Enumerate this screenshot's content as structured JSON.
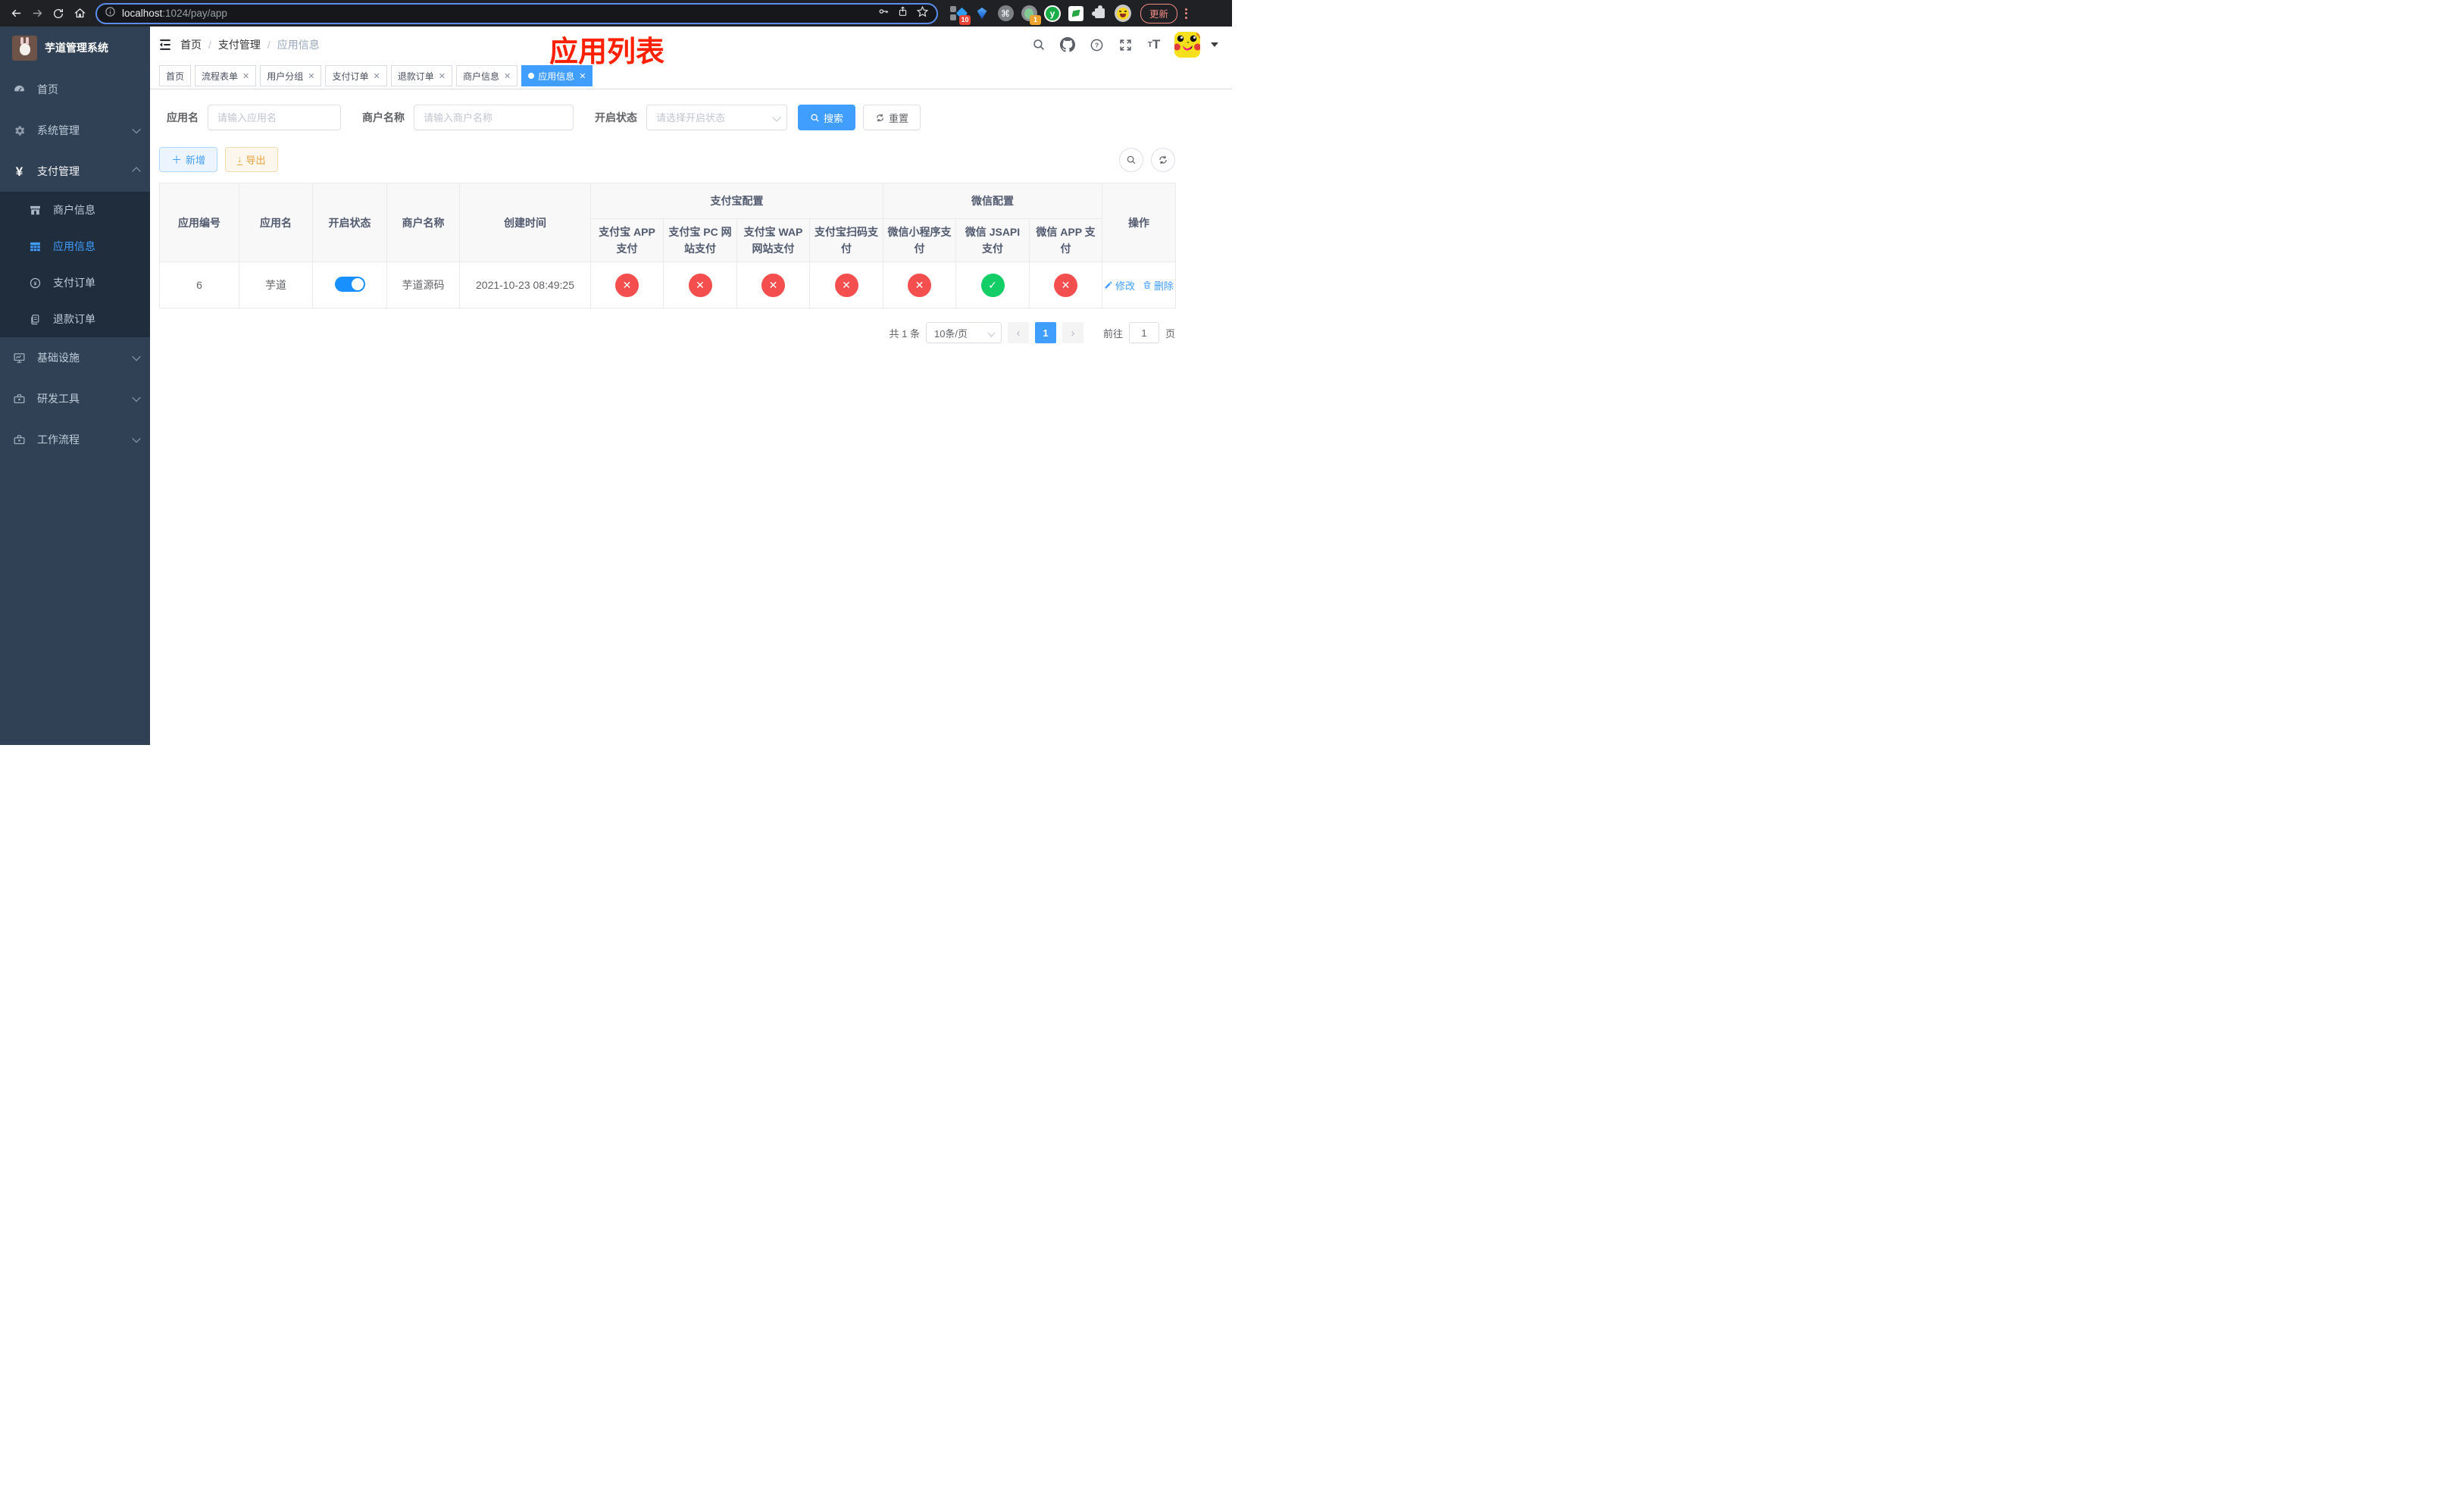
{
  "browser": {
    "url_host": "localhost",
    "url_rest": ":1024/pay/app",
    "ext_badge_blue": "10",
    "ext_badge_green": "1",
    "update_label": "更新"
  },
  "sidebar": {
    "logo_title": "芋道管理系统",
    "menu": [
      {
        "label": "首页"
      },
      {
        "label": "系统管理"
      },
      {
        "label": "支付管理"
      }
    ],
    "submenu": [
      {
        "label": "商户信息"
      },
      {
        "label": "应用信息"
      },
      {
        "label": "支付订单"
      },
      {
        "label": "退款订单"
      }
    ],
    "menu_bottom": [
      {
        "label": "基础设施"
      },
      {
        "label": "研发工具"
      },
      {
        "label": "工作流程"
      }
    ]
  },
  "header": {
    "breadcrumb": [
      "首页",
      "支付管理",
      "应用信息"
    ],
    "annotation": "应用列表"
  },
  "tabs": [
    {
      "label": "首页"
    },
    {
      "label": "流程表单"
    },
    {
      "label": "用户分组"
    },
    {
      "label": "支付订单"
    },
    {
      "label": "退款订单"
    },
    {
      "label": "商户信息"
    },
    {
      "label": "应用信息"
    }
  ],
  "filters": {
    "app_name_label": "应用名",
    "app_name_placeholder": "请输入应用名",
    "merchant_label": "商户名称",
    "merchant_placeholder": "请输入商户名称",
    "status_label": "开启状态",
    "status_placeholder": "请选择开启状态",
    "search_label": "搜索",
    "reset_label": "重置"
  },
  "toolbar": {
    "add_label": "新增",
    "export_label": "导出"
  },
  "table": {
    "headers": {
      "app_id": "应用编号",
      "app_name": "应用名",
      "status": "开启状态",
      "merchant": "商户名称",
      "created": "创建时间",
      "alipay_group": "支付宝配置",
      "wechat_group": "微信配置",
      "alipay_app": "支付宝 APP 支付",
      "alipay_pc": "支付宝 PC 网站支付",
      "alipay_wap": "支付宝 WAP 网站支付",
      "alipay_qr": "支付宝扫码支付",
      "wx_mini": "微信小程序支付",
      "wx_jsapi": "微信 JSAPI 支付",
      "wx_app": "微信 APP 支付",
      "actions": "操作"
    },
    "row": {
      "app_id": "6",
      "app_name": "芋道",
      "enabled": true,
      "merchant": "芋道源码",
      "created": "2021-10-23 08:49:25",
      "channels": {
        "alipay_app": false,
        "alipay_pc": false,
        "alipay_wap": false,
        "alipay_qr": false,
        "wx_mini": false,
        "wx_jsapi": true,
        "wx_app": false
      },
      "edit_label": "修改",
      "delete_label": "删除"
    }
  },
  "pagination": {
    "total": "共 1 条",
    "page_size": "10条/页",
    "page": "1",
    "goto_label": "前往",
    "goto_value": "1",
    "unit_label": "页"
  },
  "colors": {
    "primary": "#409eff",
    "toggle_on": "#1890ff",
    "danger": "#f44e4e",
    "success": "#13ce66",
    "annotation": "#ff2000",
    "warning": "#e6a23c"
  }
}
